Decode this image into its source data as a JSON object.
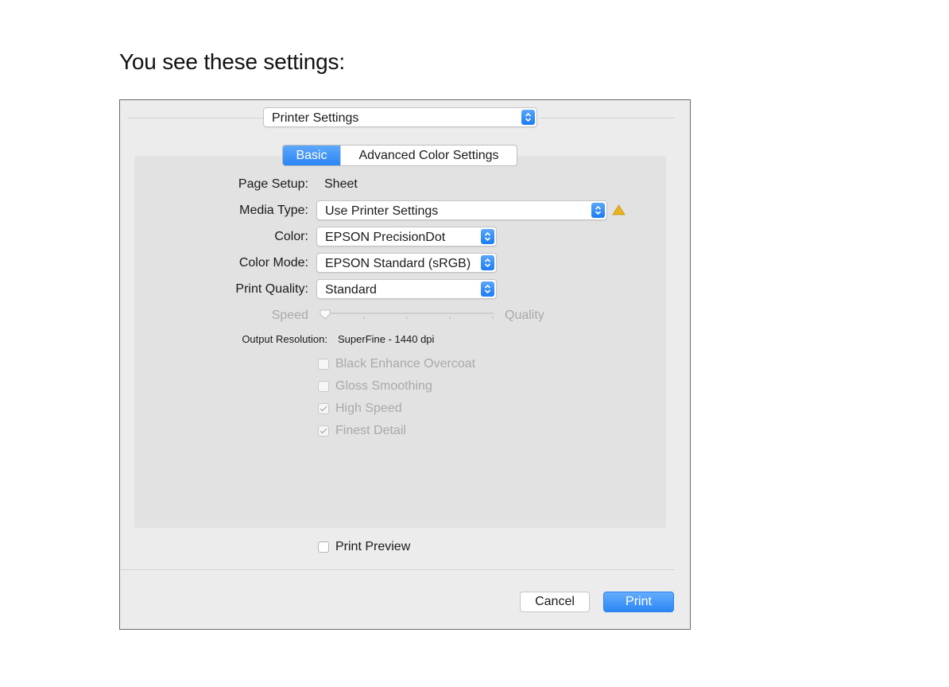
{
  "intro_text": "You see these settings:",
  "dialog": {
    "panel_select": "Printer Settings",
    "tabs": [
      {
        "label": "Basic",
        "active": true
      },
      {
        "label": "Advanced Color Settings",
        "active": false
      }
    ],
    "page_setup": {
      "label": "Page Setup:",
      "value": "Sheet"
    },
    "media_type": {
      "label": "Media Type:",
      "value": "Use Printer Settings"
    },
    "color": {
      "label": "Color:",
      "value": "EPSON PrecisionDot"
    },
    "color_mode": {
      "label": "Color Mode:",
      "value": "EPSON Standard (sRGB)"
    },
    "print_quality": {
      "label": "Print Quality:",
      "value": "Standard"
    },
    "slider": {
      "left_label": "Speed",
      "right_label": "Quality",
      "position": 0
    },
    "output_resolution": {
      "label": "Output Resolution:",
      "value": "SuperFine - 1440 dpi"
    },
    "options": [
      {
        "label": "Black Enhance Overcoat",
        "checked": false,
        "enabled": false
      },
      {
        "label": "Gloss Smoothing",
        "checked": false,
        "enabled": false
      },
      {
        "label": "High Speed",
        "checked": true,
        "enabled": false
      },
      {
        "label": "Finest Detail",
        "checked": true,
        "enabled": false
      }
    ],
    "print_preview": {
      "label": "Print Preview",
      "checked": false
    },
    "buttons": {
      "cancel": "Cancel",
      "print": "Print"
    }
  },
  "colors": {
    "accent": "#2a86f5",
    "warning": "#e8b21a"
  }
}
